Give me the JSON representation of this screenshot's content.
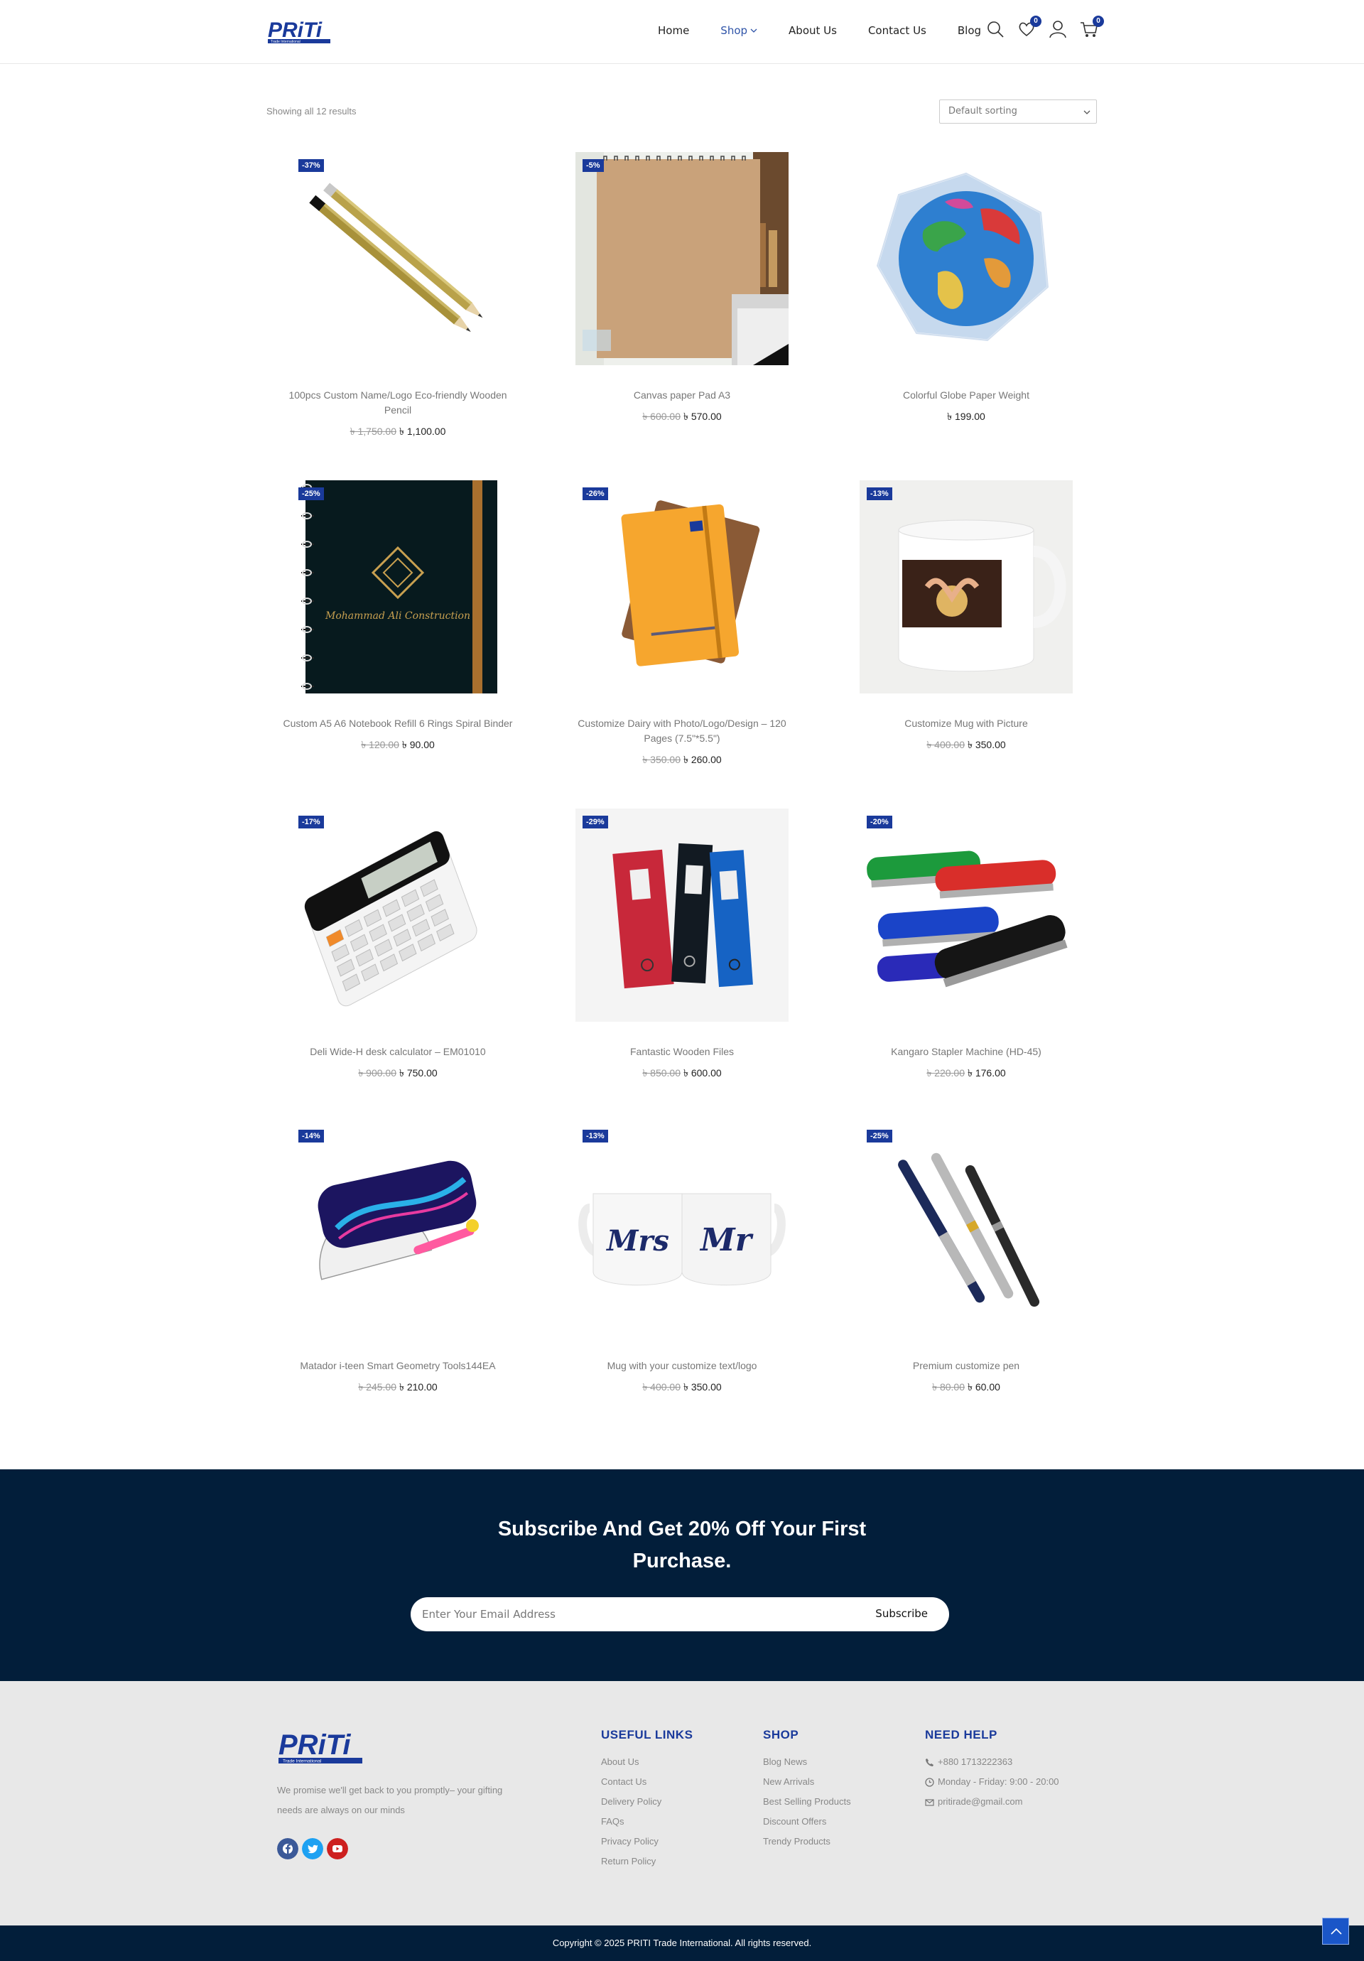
{
  "header": {
    "logo_text": "PRiTi",
    "logo_sub": "Trade International",
    "nav": [
      "Home",
      "Shop",
      "About Us",
      "Contact Us",
      "Blog"
    ],
    "wishlist_count": "0",
    "cart_count": "0"
  },
  "toolbar": {
    "result_count": "Showing all 12 results",
    "sort_value": "Default sorting"
  },
  "products": [
    {
      "title": "100pcs Custom Name/Logo Eco-friendly Wooden Pencil",
      "badge": "-37%",
      "old": "৳ 1,750.00",
      "price": "৳ 1,100.00"
    },
    {
      "title": "Canvas paper Pad A3",
      "badge": "-5%",
      "old": "৳ 600.00",
      "price": "৳ 570.00"
    },
    {
      "title": "Colorful Globe Paper Weight",
      "badge": "",
      "old": "",
      "price": "৳ 199.00"
    },
    {
      "title": "Custom A5 A6 Notebook Refill 6 Rings Spiral Binder",
      "badge": "-25%",
      "old": "৳ 120.00",
      "price": "৳ 90.00",
      "image_text": "Mohammad Ali Construction"
    },
    {
      "title": "Customize Dairy with Photo/Logo/Design – 120 Pages (7.5\"*5.5\")",
      "badge": "-26%",
      "old": "৳ 350.00",
      "price": "৳ 260.00"
    },
    {
      "title": "Customize Mug with Picture",
      "badge": "-13%",
      "old": "৳ 400.00",
      "price": "৳ 350.00"
    },
    {
      "title": "Deli Wide-H desk calculator – EM01010",
      "badge": "-17%",
      "old": "৳ 900.00",
      "price": "৳ 750.00"
    },
    {
      "title": "Fantastic Wooden Files",
      "badge": "-29%",
      "old": "৳ 850.00",
      "price": "৳ 600.00"
    },
    {
      "title": "Kangaro Stapler Machine (HD-45)",
      "badge": "-20%",
      "old": "৳ 220.00",
      "price": "৳ 176.00"
    },
    {
      "title": "Matador i-teen Smart Geometry Tools144EA",
      "badge": "-14%",
      "old": "৳ 245.00",
      "price": "৳ 210.00"
    },
    {
      "title": "Mug with your customize text/logo",
      "badge": "-13%",
      "old": "৳ 400.00",
      "price": "৳ 350.00",
      "image_text": [
        "Mrs",
        "Mr"
      ]
    },
    {
      "title": "Premium customize pen",
      "badge": "-25%",
      "old": "৳ 80.00",
      "price": "৳ 60.00"
    }
  ],
  "subscribe": {
    "title": "Subscribe And Get 20% Off Your First Purchase.",
    "placeholder": "Enter Your Email Address",
    "button": "Subscribe"
  },
  "footer": {
    "tagline": "We promise we'll get back to you promptly– your gifting needs are always on our minds",
    "useful_links": {
      "heading": "USEFUL LINKS",
      "items": [
        "About Us",
        "Contact Us",
        "Delivery Policy",
        "FAQs",
        "Privacy Policy",
        "Return Policy"
      ]
    },
    "shop": {
      "heading": "SHOP",
      "items": [
        "Blog News",
        "New Arrivals",
        "Best Selling Products",
        "Discount Offers",
        "Trendy Products"
      ]
    },
    "help": {
      "heading": "NEED HELP",
      "phone": "+880 1713222363",
      "hours": "Monday - Friday: 9:00 - 20:00",
      "email": "pritirade@gmail.com"
    },
    "social": [
      {
        "name": "facebook-icon",
        "color": "#3b5998"
      },
      {
        "name": "twitter-icon",
        "color": "#1da1f2"
      },
      {
        "name": "youtube-icon",
        "color": "#cd201f"
      }
    ],
    "copyright": "Copyright © 2025 PRITI Trade International. All rights reserved."
  },
  "colors": {
    "brand": "#1a3a9b",
    "dark_band": "#021e3a",
    "footer_bg": "#e8e8e8"
  }
}
